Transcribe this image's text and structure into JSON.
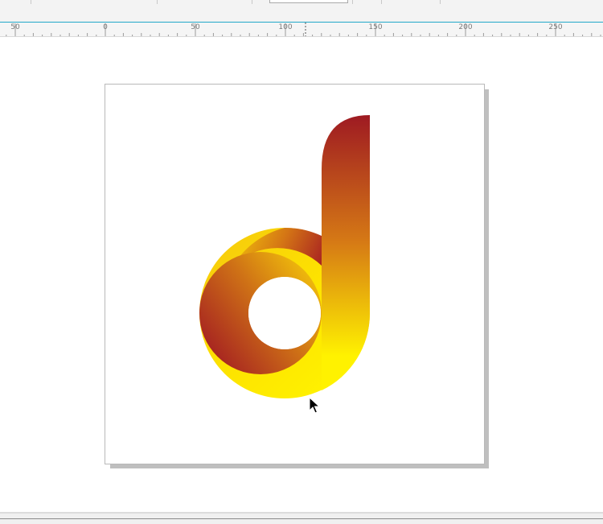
{
  "ruler": {
    "labels": [
      "50",
      "0",
      "50",
      "100",
      "150",
      "200",
      "250"
    ]
  },
  "colors": {
    "gradient_top": "#9e1a22",
    "gradient_mid": "#d67a15",
    "gradient_bottom": "#fff200",
    "page_shadow": "#bfbfbf",
    "accent_line": "#23a9c9"
  },
  "icons": {
    "cursor": "arrow-cursor-icon"
  }
}
